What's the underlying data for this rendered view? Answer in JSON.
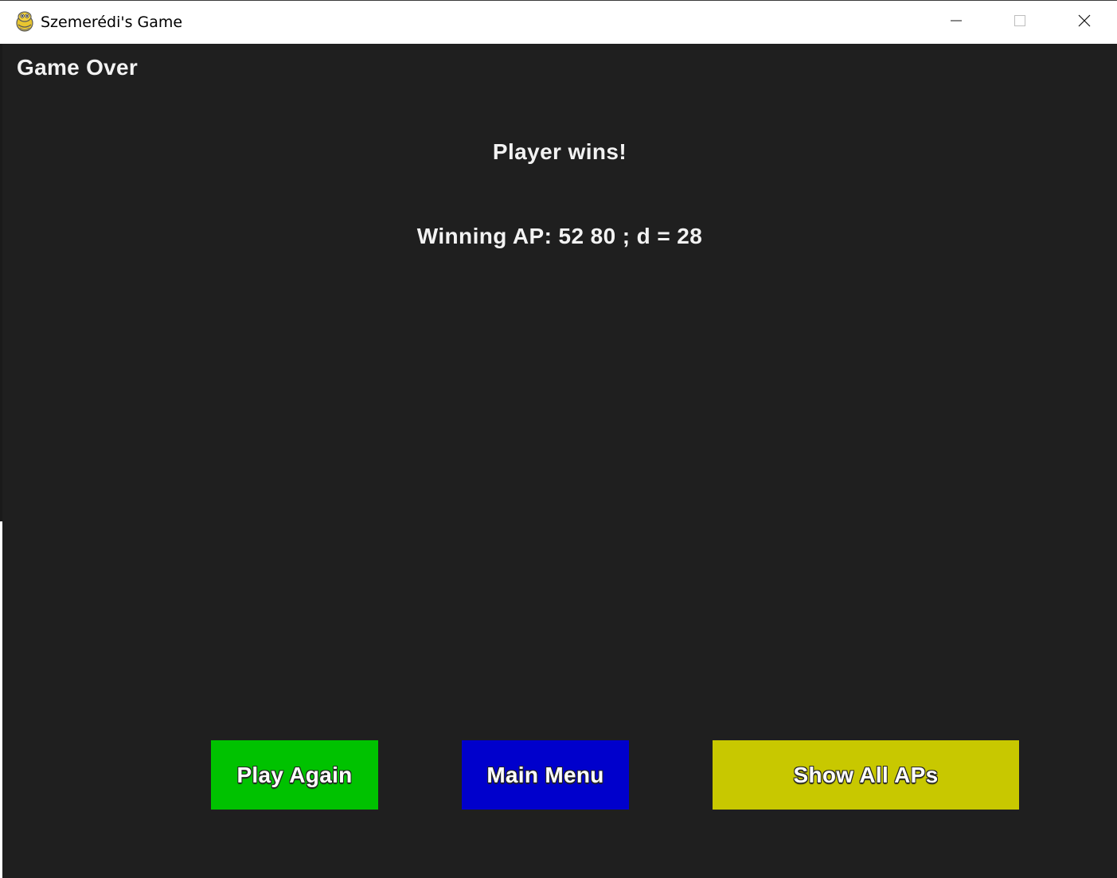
{
  "window": {
    "title": "Szemerédi's Game",
    "app_icon": "pygame-snake-icon",
    "controls": {
      "minimize_icon": "minimize-icon",
      "maximize_icon": "maximize-icon",
      "close_icon": "close-icon"
    }
  },
  "screen": {
    "title": "Game Over",
    "winner_text": "Player wins!",
    "winning_ap_text": "Winning AP: 52 80 ; d = 28",
    "background_color": "#1f1f1f",
    "text_color": "#f2f2f2"
  },
  "buttons": {
    "play_again": {
      "label": "Play Again",
      "color": "#00c200"
    },
    "main_menu": {
      "label": "Main Menu",
      "color": "#0000cc"
    },
    "show_all_aps": {
      "label": "Show All APs",
      "color": "#c8c800"
    }
  }
}
